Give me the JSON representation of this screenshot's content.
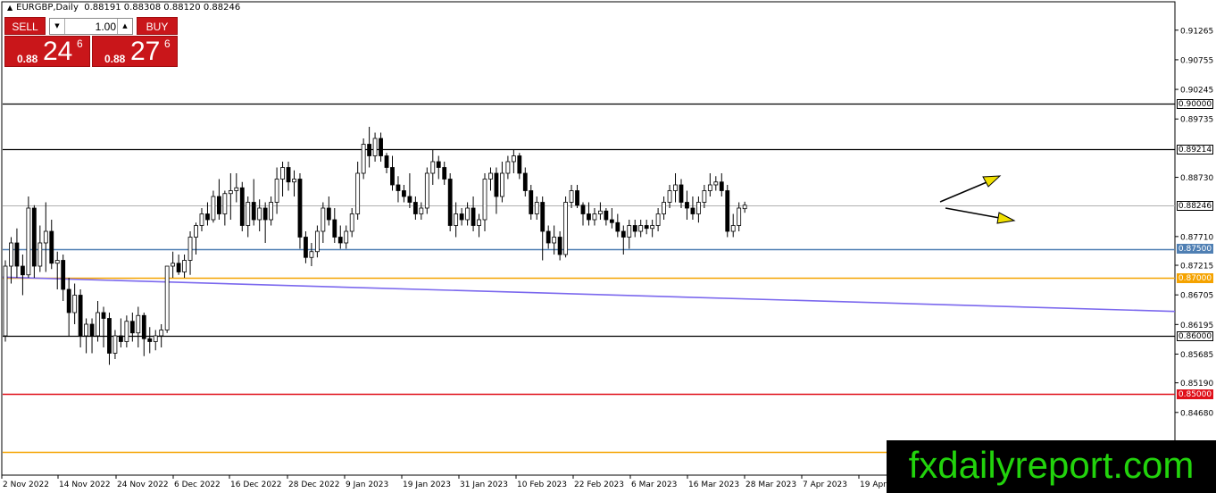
{
  "header": {
    "symbol_timeframe": "EURGBP,Daily",
    "ohlc": "0.88191 0.88308 0.88120 0.88246"
  },
  "trade_panel": {
    "sell_label": "SELL",
    "buy_label": "BUY",
    "lot_value": "1.00",
    "sell_quote": {
      "prefix": "0.88",
      "big": "24",
      "sup": "6"
    },
    "buy_quote": {
      "prefix": "0.88",
      "big": "27",
      "sup": "6"
    }
  },
  "price_axis": {
    "labels": [
      "0.91265",
      "0.90755",
      "0.90245",
      "0.89735",
      "0.88730",
      "0.87710",
      "0.87215",
      "0.86705",
      "0.86195",
      "0.85685",
      "0.85190",
      "0.84680"
    ],
    "tags": [
      {
        "text": "0.90000",
        "bg": "#ffffff",
        "fg": "#000000"
      },
      {
        "text": "0.89214",
        "bg": "#ffffff",
        "fg": "#000000"
      },
      {
        "text": "0.88246",
        "bg": "#ffffff",
        "fg": "#000000"
      },
      {
        "text": "0.87500",
        "bg": "#4f7fb3",
        "fg": "#ffffff"
      },
      {
        "text": "0.87000",
        "bg": "#f5a300",
        "fg": "#ffffff"
      },
      {
        "text": "0.86000",
        "bg": "#ffffff",
        "fg": "#000000"
      },
      {
        "text": "0.85000",
        "bg": "#e0101a",
        "fg": "#ffffff"
      }
    ]
  },
  "time_axis": {
    "labels": [
      "2 Nov 2022",
      "14 Nov 2022",
      "24 Nov 2022",
      "6 Dec 2022",
      "16 Dec 2022",
      "28 Dec 2022",
      "9 Jan 2023",
      "19 Jan 2023",
      "31 Jan 2023",
      "10 Feb 2023",
      "22 Feb 2023",
      "6 Mar 2023",
      "16 Mar 2023",
      "28 Mar 2023",
      "7 Apr 2023",
      "19 Apr"
    ]
  },
  "watermark": "fxdailyreport.com",
  "chart_data": {
    "type": "candlestick",
    "symbol": "EURGBP",
    "timeframe": "Daily",
    "ylim": [
      0.844,
      0.916
    ],
    "horizontal_levels": [
      {
        "value": 0.9,
        "color": "#000000"
      },
      {
        "value": 0.89214,
        "color": "#000000"
      },
      {
        "value": 0.88246,
        "color": "#b0b0b0"
      },
      {
        "value": 0.875,
        "color": "#4f7fb3"
      },
      {
        "value": 0.87,
        "color": "#f5a300"
      },
      {
        "value": 0.86,
        "color": "#000000"
      },
      {
        "value": 0.85,
        "color": "#e0101a"
      },
      {
        "value": 0.84,
        "color": "#f5a300"
      }
    ],
    "trendline": {
      "from": [
        "2 Nov 2022",
        0.8701
      ],
      "to": [
        "28 Apr 2023",
        0.8642
      ],
      "color": "#7b68ee"
    },
    "arrows": [
      {
        "direction": "up",
        "color": "#f0e000"
      },
      {
        "direction": "down",
        "color": "#f0e000"
      }
    ],
    "candles": [
      [
        0.86,
        0.873,
        0.859,
        0.872
      ],
      [
        0.872,
        0.877,
        0.869,
        0.876
      ],
      [
        0.876,
        0.8785,
        0.87,
        0.872
      ],
      [
        0.872,
        0.874,
        0.867,
        0.8705
      ],
      [
        0.8705,
        0.884,
        0.87,
        0.882
      ],
      [
        0.882,
        0.8825,
        0.87,
        0.872
      ],
      [
        0.872,
        0.879,
        0.871,
        0.876
      ],
      [
        0.876,
        0.883,
        0.871,
        0.878
      ],
      [
        0.878,
        0.88,
        0.8715,
        0.8725
      ],
      [
        0.8725,
        0.8745,
        0.868,
        0.873
      ],
      [
        0.873,
        0.874,
        0.866,
        0.868
      ],
      [
        0.868,
        0.87,
        0.86,
        0.864
      ],
      [
        0.864,
        0.869,
        0.862,
        0.867
      ],
      [
        0.867,
        0.868,
        0.858,
        0.86
      ],
      [
        0.86,
        0.863,
        0.857,
        0.862
      ],
      [
        0.862,
        0.863,
        0.857,
        0.86
      ],
      [
        0.86,
        0.866,
        0.859,
        0.864
      ],
      [
        0.864,
        0.865,
        0.858,
        0.863
      ],
      [
        0.863,
        0.864,
        0.855,
        0.857
      ],
      [
        0.857,
        0.861,
        0.856,
        0.86
      ],
      [
        0.86,
        0.863,
        0.858,
        0.859
      ],
      [
        0.859,
        0.8635,
        0.858,
        0.8625
      ],
      [
        0.8625,
        0.864,
        0.859,
        0.8605
      ],
      [
        0.8605,
        0.865,
        0.858,
        0.8635
      ],
      [
        0.8635,
        0.864,
        0.8565,
        0.8595
      ],
      [
        0.8595,
        0.8615,
        0.857,
        0.859
      ],
      [
        0.859,
        0.861,
        0.8575,
        0.86
      ],
      [
        0.86,
        0.862,
        0.858,
        0.861
      ],
      [
        0.861,
        0.872,
        0.8605,
        0.872
      ],
      [
        0.872,
        0.8745,
        0.87,
        0.8725
      ],
      [
        0.8725,
        0.874,
        0.8705,
        0.871
      ],
      [
        0.871,
        0.874,
        0.87,
        0.873
      ],
      [
        0.873,
        0.878,
        0.8705,
        0.877
      ],
      [
        0.877,
        0.8795,
        0.874,
        0.879
      ],
      [
        0.879,
        0.882,
        0.878,
        0.881
      ],
      [
        0.881,
        0.883,
        0.879,
        0.88
      ],
      [
        0.88,
        0.885,
        0.8795,
        0.884
      ],
      [
        0.884,
        0.887,
        0.88,
        0.881
      ],
      [
        0.881,
        0.885,
        0.879,
        0.8845
      ],
      [
        0.8845,
        0.888,
        0.88,
        0.885
      ],
      [
        0.885,
        0.888,
        0.883,
        0.8855
      ],
      [
        0.8855,
        0.8865,
        0.878,
        0.879
      ],
      [
        0.879,
        0.884,
        0.877,
        0.883
      ],
      [
        0.883,
        0.887,
        0.879,
        0.88
      ],
      [
        0.88,
        0.8835,
        0.878,
        0.882
      ],
      [
        0.882,
        0.883,
        0.876,
        0.88
      ],
      [
        0.88,
        0.884,
        0.879,
        0.883
      ],
      [
        0.883,
        0.889,
        0.881,
        0.887
      ],
      [
        0.887,
        0.89,
        0.884,
        0.889
      ],
      [
        0.889,
        0.89,
        0.885,
        0.8865
      ],
      [
        0.8865,
        0.8885,
        0.884,
        0.887
      ],
      [
        0.887,
        0.888,
        0.875,
        0.877
      ],
      [
        0.877,
        0.878,
        0.8725,
        0.8735
      ],
      [
        0.8735,
        0.876,
        0.872,
        0.8745
      ],
      [
        0.8745,
        0.879,
        0.8735,
        0.878
      ],
      [
        0.878,
        0.883,
        0.876,
        0.882
      ],
      [
        0.882,
        0.884,
        0.879,
        0.88
      ],
      [
        0.88,
        0.882,
        0.876,
        0.877
      ],
      [
        0.877,
        0.879,
        0.875,
        0.876
      ],
      [
        0.876,
        0.879,
        0.875,
        0.878
      ],
      [
        0.878,
        0.882,
        0.877,
        0.881
      ],
      [
        0.881,
        0.89,
        0.88,
        0.888
      ],
      [
        0.888,
        0.894,
        0.887,
        0.893
      ],
      [
        0.893,
        0.896,
        0.889,
        0.891
      ],
      [
        0.891,
        0.895,
        0.89,
        0.894
      ],
      [
        0.894,
        0.895,
        0.89,
        0.891
      ],
      [
        0.891,
        0.8915,
        0.888,
        0.889
      ],
      [
        0.889,
        0.891,
        0.885,
        0.886
      ],
      [
        0.886,
        0.8875,
        0.883,
        0.885
      ],
      [
        0.885,
        0.886,
        0.883,
        0.884
      ],
      [
        0.884,
        0.888,
        0.882,
        0.883
      ],
      [
        0.883,
        0.884,
        0.88,
        0.881
      ],
      [
        0.881,
        0.883,
        0.88,
        0.882
      ],
      [
        0.882,
        0.889,
        0.881,
        0.888
      ],
      [
        0.888,
        0.892,
        0.886,
        0.89
      ],
      [
        0.89,
        0.891,
        0.887,
        0.889
      ],
      [
        0.889,
        0.89,
        0.886,
        0.887
      ],
      [
        0.887,
        0.888,
        0.878,
        0.879
      ],
      [
        0.879,
        0.883,
        0.877,
        0.881
      ],
      [
        0.881,
        0.882,
        0.879,
        0.88
      ],
      [
        0.88,
        0.883,
        0.879,
        0.882
      ],
      [
        0.882,
        0.884,
        0.878,
        0.879
      ],
      [
        0.879,
        0.881,
        0.877,
        0.88
      ],
      [
        0.88,
        0.888,
        0.878,
        0.887
      ],
      [
        0.887,
        0.889,
        0.885,
        0.888
      ],
      [
        0.888,
        0.889,
        0.881,
        0.884
      ],
      [
        0.884,
        0.89,
        0.883,
        0.888
      ],
      [
        0.888,
        0.891,
        0.887,
        0.89
      ],
      [
        0.89,
        0.892,
        0.888,
        0.891
      ],
      [
        0.891,
        0.8915,
        0.887,
        0.888
      ],
      [
        0.888,
        0.889,
        0.884,
        0.885
      ],
      [
        0.885,
        0.886,
        0.88,
        0.881
      ],
      [
        0.881,
        0.884,
        0.88,
        0.883
      ],
      [
        0.883,
        0.884,
        0.873,
        0.878
      ],
      [
        0.878,
        0.879,
        0.875,
        0.876
      ],
      [
        0.876,
        0.879,
        0.874,
        0.877
      ],
      [
        0.877,
        0.878,
        0.873,
        0.874
      ],
      [
        0.874,
        0.884,
        0.8735,
        0.883
      ],
      [
        0.883,
        0.886,
        0.882,
        0.885
      ],
      [
        0.885,
        0.886,
        0.882,
        0.8825
      ],
      [
        0.8825,
        0.883,
        0.879,
        0.881
      ],
      [
        0.881,
        0.883,
        0.879,
        0.88
      ],
      [
        0.88,
        0.882,
        0.879,
        0.881
      ],
      [
        0.881,
        0.883,
        0.88,
        0.8815
      ],
      [
        0.8815,
        0.882,
        0.879,
        0.88
      ],
      [
        0.88,
        0.882,
        0.8785,
        0.8795
      ],
      [
        0.8795,
        0.881,
        0.877,
        0.878
      ],
      [
        0.878,
        0.879,
        0.874,
        0.877
      ],
      [
        0.877,
        0.88,
        0.875,
        0.879
      ],
      [
        0.879,
        0.88,
        0.877,
        0.878
      ],
      [
        0.878,
        0.88,
        0.877,
        0.879
      ],
      [
        0.879,
        0.88,
        0.8775,
        0.8785
      ],
      [
        0.8785,
        0.88,
        0.877,
        0.879
      ],
      [
        0.879,
        0.882,
        0.878,
        0.881
      ],
      [
        0.881,
        0.884,
        0.88,
        0.883
      ],
      [
        0.883,
        0.886,
        0.882,
        0.885
      ],
      [
        0.885,
        0.888,
        0.883,
        0.886
      ],
      [
        0.886,
        0.887,
        0.882,
        0.883
      ],
      [
        0.883,
        0.885,
        0.88,
        0.882
      ],
      [
        0.882,
        0.884,
        0.88,
        0.881
      ],
      [
        0.881,
        0.884,
        0.8795,
        0.883
      ],
      [
        0.883,
        0.886,
        0.882,
        0.885
      ],
      [
        0.885,
        0.888,
        0.884,
        0.886
      ],
      [
        0.886,
        0.8875,
        0.885,
        0.8865
      ],
      [
        0.8865,
        0.888,
        0.884,
        0.885
      ],
      [
        0.885,
        0.886,
        0.877,
        0.878
      ],
      [
        0.878,
        0.881,
        0.877,
        0.879
      ],
      [
        0.879,
        0.883,
        0.878,
        0.882
      ],
      [
        0.8819,
        0.8831,
        0.8812,
        0.8825
      ]
    ]
  }
}
